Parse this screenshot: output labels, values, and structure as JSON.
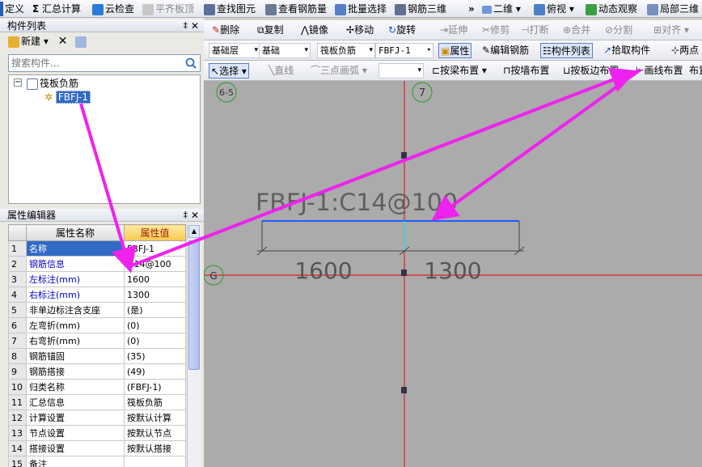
{
  "toolbar_top": {
    "items": [
      "定义",
      "汇总计算",
      "云检查",
      "平齐板顶",
      "查找图元",
      "查看钢筋量",
      "批量选择",
      "钢筋三维",
      "二维",
      "俯视",
      "动态观察",
      "局部三维"
    ],
    "more": "»"
  },
  "component_list": {
    "title": "构件列表",
    "new_label": "新建",
    "search_placeholder": "搜索构件...",
    "tree": {
      "parent": "筏板负筋",
      "child": "FBFJ-1"
    }
  },
  "property_editor": {
    "title": "属性编辑器",
    "col_name": "属性名称",
    "col_value": "属性值",
    "rows": [
      {
        "n": "1",
        "name": "名称",
        "value": "FBFJ-1"
      },
      {
        "n": "2",
        "name": "钢筋信息",
        "value": "Φ14@100"
      },
      {
        "n": "3",
        "name": "左标注(mm)",
        "value": "1600"
      },
      {
        "n": "4",
        "name": "右标注(mm)",
        "value": "1300"
      },
      {
        "n": "5",
        "name": "非单边标注含支座",
        "value": "(是)"
      },
      {
        "n": "6",
        "name": "左弯折(mm)",
        "value": "(0)"
      },
      {
        "n": "7",
        "name": "右弯折(mm)",
        "value": "(0)"
      },
      {
        "n": "8",
        "name": "钢筋锚固",
        "value": "(35)"
      },
      {
        "n": "9",
        "name": "钢筋搭接",
        "value": "(49)"
      },
      {
        "n": "10",
        "name": "归类名称",
        "value": "(FBFJ-1)"
      },
      {
        "n": "11",
        "name": "汇总信息",
        "value": "筏板负筋"
      },
      {
        "n": "12",
        "name": "计算设置",
        "value": "按默认计算"
      },
      {
        "n": "13",
        "name": "节点设置",
        "value": "按默认节点"
      },
      {
        "n": "14",
        "name": "搭接设置",
        "value": "按默认搭接"
      },
      {
        "n": "15",
        "name": "备注",
        "value": ""
      }
    ]
  },
  "edit_toolbar": {
    "items": [
      "删除",
      "复制",
      "镜像",
      "移动",
      "旋转",
      "延伸",
      "修剪",
      "打断",
      "合并",
      "分割",
      "对齐"
    ]
  },
  "layer_toolbar": {
    "combo_floor": "基础层",
    "combo_type": "基础",
    "combo_cat": "筏板负筋",
    "combo_comp": "FBFJ-1",
    "btn_props": "属性",
    "btn_edit_rebar": "编辑钢筋",
    "btn_comp_list": "构件列表",
    "btn_pick": "拾取构件",
    "btn_two": "两点"
  },
  "draw_toolbar": {
    "select": "选择",
    "line": "直线",
    "arc": "三点画弧",
    "by_beam": "按梁布置",
    "by_wall": "按墙布置",
    "by_slab_edge": "按板边布置",
    "draw_line": "画线布置",
    "layout": "布置"
  },
  "canvas": {
    "label": "FBFJ-1:C14@100",
    "dim_left": "1600",
    "dim_right": "1300",
    "axes": [
      "6-5",
      "7",
      "G"
    ]
  },
  "colors": {
    "annotation_arrow": "#ee22ee",
    "axis_red": "#e02020",
    "rebar_blue": "#1e5cff"
  }
}
